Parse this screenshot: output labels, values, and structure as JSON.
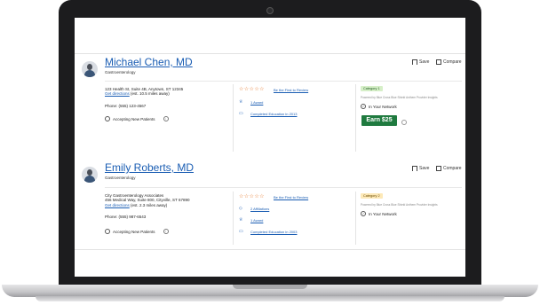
{
  "doctors": [
    {
      "name": "Michael Chen, MD",
      "specialty": "Gastroenterology",
      "address_lines": [
        "123 Health St, Suite 4B, Anytown, ST 12345"
      ],
      "directions_link": "Get directions",
      "distance": "(est. 10.5 miles away)",
      "phone": "Phone: (555) 123-4567",
      "accepting": "Accepting New Patients",
      "review_link": "Be the First to Review",
      "items": [
        {
          "icon": "award-icon",
          "text": "1 Award"
        },
        {
          "icon": "graduation-icon",
          "text": "Completed Education in 2013"
        }
      ],
      "category": "Category 1",
      "category_color": "#d6efc8",
      "powered": "Powered by Blue Cross Blue Shield Anthem Provider Insights",
      "network": "In Your Network",
      "earn_label": "Earn $25",
      "save_label": "Save",
      "compare_label": "Compare"
    },
    {
      "name": "Emily Roberts, MD",
      "specialty": "Gastroenterology",
      "address_lines": [
        "City Gastroenterology Associates",
        "456 Medical Way, Suite 800, Cityville, ST 67890"
      ],
      "directions_link": "Get directions",
      "distance": "(est. 2.3 miles away)",
      "phone": "Phone: (555) 987-6543",
      "accepting": "Accepting New Patients",
      "review_link": "Be the First to Review",
      "items": [
        {
          "icon": "affiliation-icon",
          "text": "2 Affiliations"
        },
        {
          "icon": "award-icon",
          "text": "1 Award"
        },
        {
          "icon": "graduation-icon",
          "text": "Completed Education in 2003"
        }
      ],
      "category": "Category 2",
      "category_color": "#fde9b8",
      "powered": "Powered by Blue Cross Blue Shield Anthem Provider Insights",
      "network": "In Your Network",
      "save_label": "Save",
      "compare_label": "Compare"
    }
  ],
  "colors": {
    "link": "#1a5db3",
    "star": "#e6782a",
    "earn_button": "#1f7a3f"
  }
}
